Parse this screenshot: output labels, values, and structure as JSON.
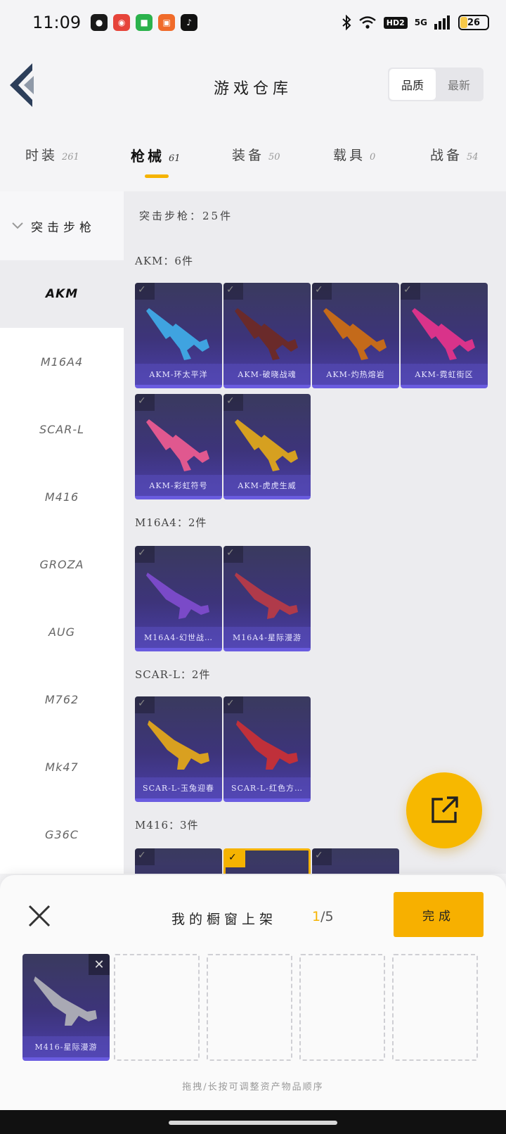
{
  "status_bar": {
    "time": "11:09",
    "network": "5G",
    "hd": "HD2",
    "battery": "26"
  },
  "header": {
    "title": "游戏仓库",
    "sort_options": [
      "品质",
      "最新"
    ],
    "active_sort": "品质"
  },
  "tabs": [
    {
      "label": "时装",
      "count": "261"
    },
    {
      "label": "枪械",
      "count": "61"
    },
    {
      "label": "装备",
      "count": "50"
    },
    {
      "label": "载具",
      "count": "0"
    },
    {
      "label": "战备",
      "count": "54"
    }
  ],
  "rail": {
    "header": "突击步枪",
    "items": [
      "AKM",
      "M16A4",
      "SCAR-L",
      "M416",
      "GROZA",
      "AUG",
      "M762",
      "Mk47",
      "G36C"
    ]
  },
  "summary": "突击步枪：25件",
  "groups": [
    {
      "title": "AKM：6件",
      "items": [
        "AKM-环太平洋",
        "AKM-破晓战魂",
        "AKM-灼热熔岩",
        "AKM-霓虹街区",
        "AKM-彩虹符号",
        "AKM-虎虎生威"
      ]
    },
    {
      "title": "M16A4：2件",
      "items": [
        "M16A4-幻世战…",
        "M16A4-星际漫游"
      ]
    },
    {
      "title": "SCAR-L：2件",
      "items": [
        "SCAR-L-玉兔迎春",
        "SCAR-L-红色方…"
      ]
    },
    {
      "title": "M416：3件",
      "items": [
        "",
        "",
        ""
      ]
    }
  ],
  "sheet": {
    "title": "我的橱窗上架",
    "current": "1",
    "total": "/5",
    "done_label": "完成",
    "slot_item": "M416-星际漫游",
    "hint": "拖拽/长按可调整资产物品顺序"
  },
  "colors": {
    "accent": "#f5b301",
    "card_bg": "#3d347a"
  }
}
